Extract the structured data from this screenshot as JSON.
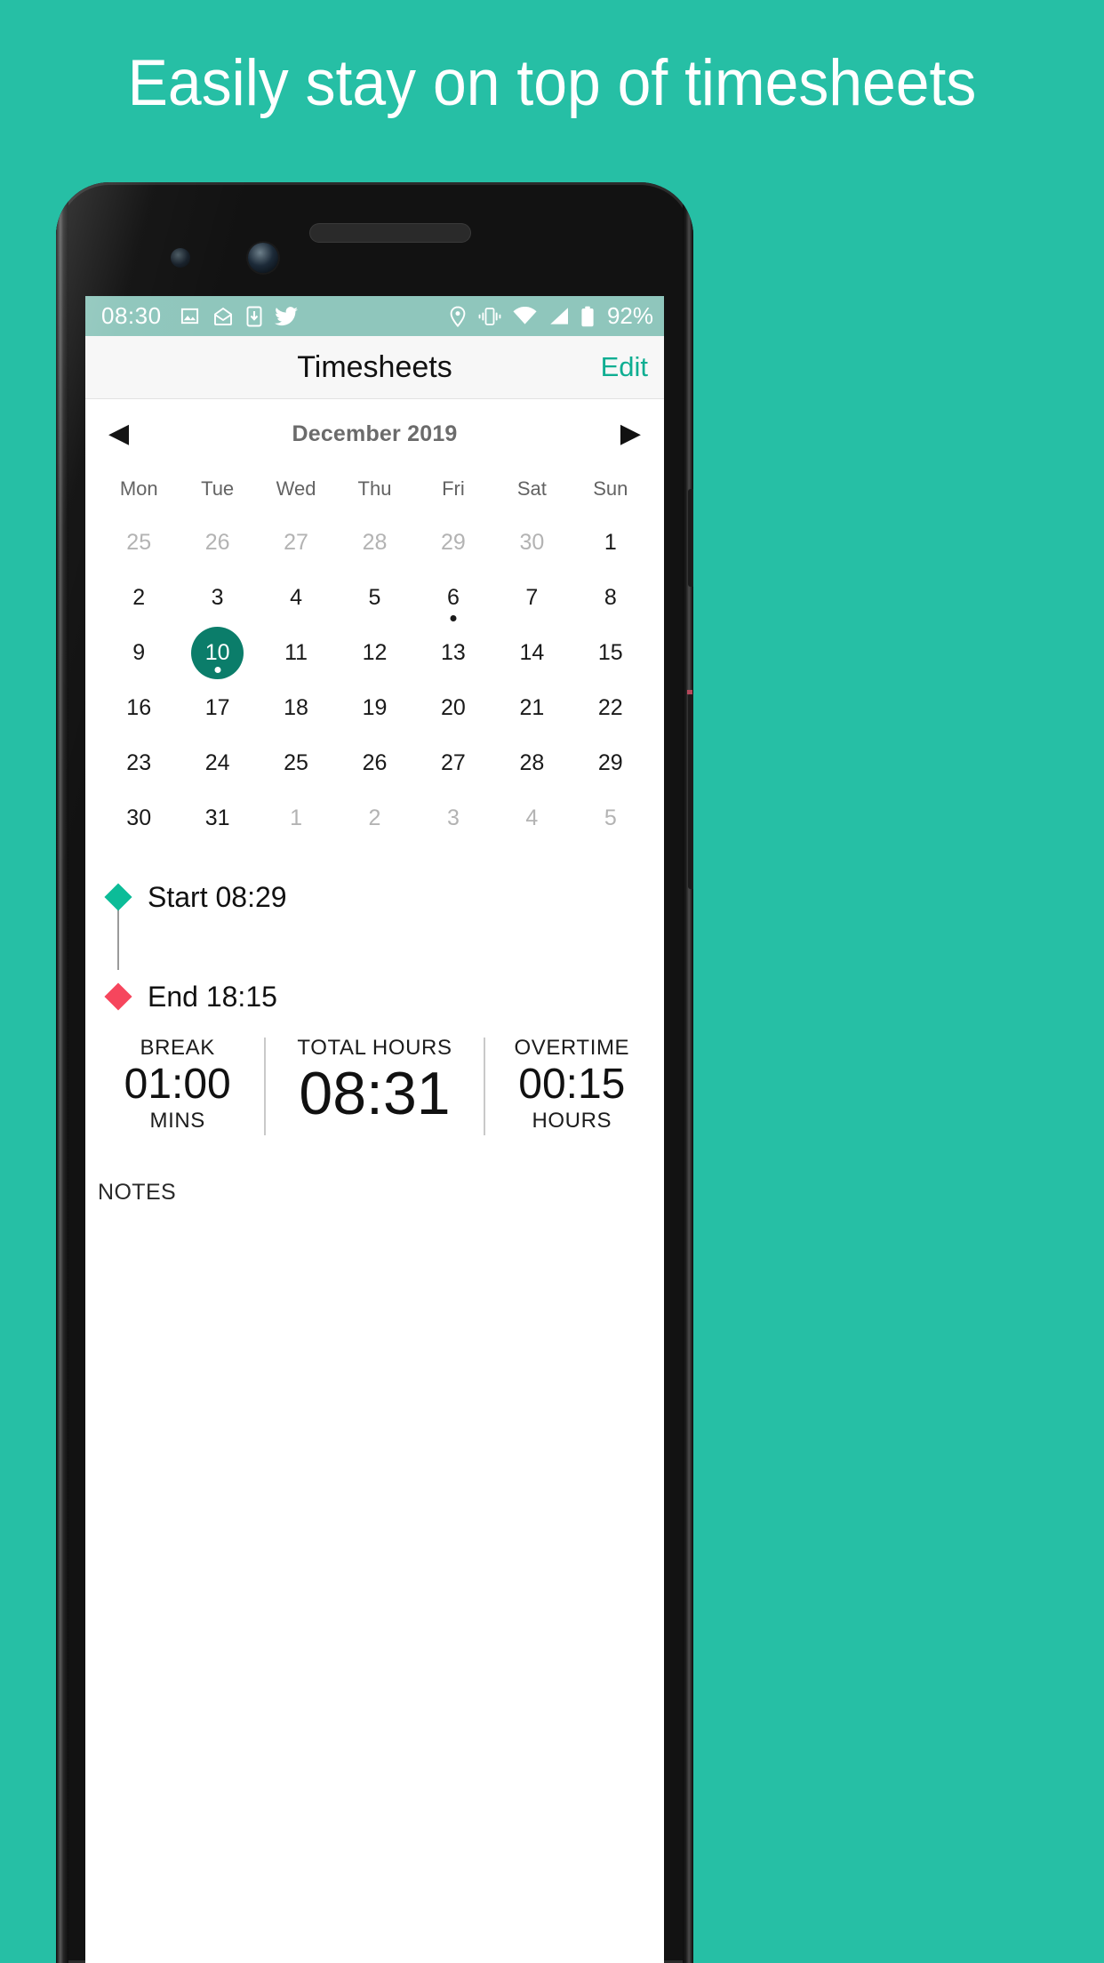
{
  "promo": {
    "headline": "Easily stay on top of timesheets",
    "background_color": "#26BFA5",
    "text_color": "#FFFFFF"
  },
  "statusbar": {
    "time": "08:30",
    "battery": "92%",
    "left_icons": [
      "image-icon",
      "mail-icon",
      "download-icon",
      "twitter-icon"
    ],
    "right_icons": [
      "location-icon",
      "vibrate-icon",
      "wifi-icon",
      "signal-icon",
      "battery-icon"
    ],
    "background_color": "#8FC6BC"
  },
  "appbar": {
    "title": "Timesheets",
    "edit_label": "Edit",
    "accent_color": "#0FAE92"
  },
  "calendar": {
    "prev_label": "◀",
    "next_label": "▶",
    "month_label": "December 2019",
    "weekdays": [
      "Mon",
      "Tue",
      "Wed",
      "Thu",
      "Fri",
      "Sat",
      "Sun"
    ],
    "selected_day": "10",
    "selected_color": "#0B7D6A",
    "weeks": [
      [
        {
          "d": "25",
          "muted": true
        },
        {
          "d": "26",
          "muted": true
        },
        {
          "d": "27",
          "muted": true
        },
        {
          "d": "28",
          "muted": true
        },
        {
          "d": "29",
          "muted": true
        },
        {
          "d": "30",
          "muted": true
        },
        {
          "d": "1",
          "muted": false
        }
      ],
      [
        {
          "d": "2",
          "muted": false
        },
        {
          "d": "3",
          "muted": false
        },
        {
          "d": "4",
          "muted": false
        },
        {
          "d": "5",
          "muted": false
        },
        {
          "d": "6",
          "muted": false,
          "dot": true
        },
        {
          "d": "7",
          "muted": false
        },
        {
          "d": "8",
          "muted": false
        }
      ],
      [
        {
          "d": "9",
          "muted": false
        },
        {
          "d": "10",
          "muted": false,
          "selected": true,
          "dot": true
        },
        {
          "d": "11",
          "muted": false
        },
        {
          "d": "12",
          "muted": false
        },
        {
          "d": "13",
          "muted": false
        },
        {
          "d": "14",
          "muted": false
        },
        {
          "d": "15",
          "muted": false
        }
      ],
      [
        {
          "d": "16",
          "muted": false
        },
        {
          "d": "17",
          "muted": false
        },
        {
          "d": "18",
          "muted": false
        },
        {
          "d": "19",
          "muted": false
        },
        {
          "d": "20",
          "muted": false
        },
        {
          "d": "21",
          "muted": false
        },
        {
          "d": "22",
          "muted": false
        }
      ],
      [
        {
          "d": "23",
          "muted": false
        },
        {
          "d": "24",
          "muted": false
        },
        {
          "d": "25",
          "muted": false
        },
        {
          "d": "26",
          "muted": false
        },
        {
          "d": "27",
          "muted": false
        },
        {
          "d": "28",
          "muted": false
        },
        {
          "d": "29",
          "muted": false
        }
      ],
      [
        {
          "d": "30",
          "muted": false
        },
        {
          "d": "31",
          "muted": false
        },
        {
          "d": "1",
          "muted": true
        },
        {
          "d": "2",
          "muted": true
        },
        {
          "d": "3",
          "muted": true
        },
        {
          "d": "4",
          "muted": true
        },
        {
          "d": "5",
          "muted": true
        }
      ]
    ]
  },
  "timeline": {
    "start_label": "Start 08:29",
    "end_label": "End 18:15",
    "start_color": "#0CBC98",
    "end_color": "#F6465D"
  },
  "stats": [
    {
      "caption": "BREAK",
      "value": "01:00",
      "unit": "MINS"
    },
    {
      "caption": "TOTAL HOURS",
      "value": "08:31",
      "unit": ""
    },
    {
      "caption": "OVERTIME",
      "value": "00:15",
      "unit": "HOURS"
    }
  ],
  "notes": {
    "caption": "NOTES",
    "value": ""
  }
}
